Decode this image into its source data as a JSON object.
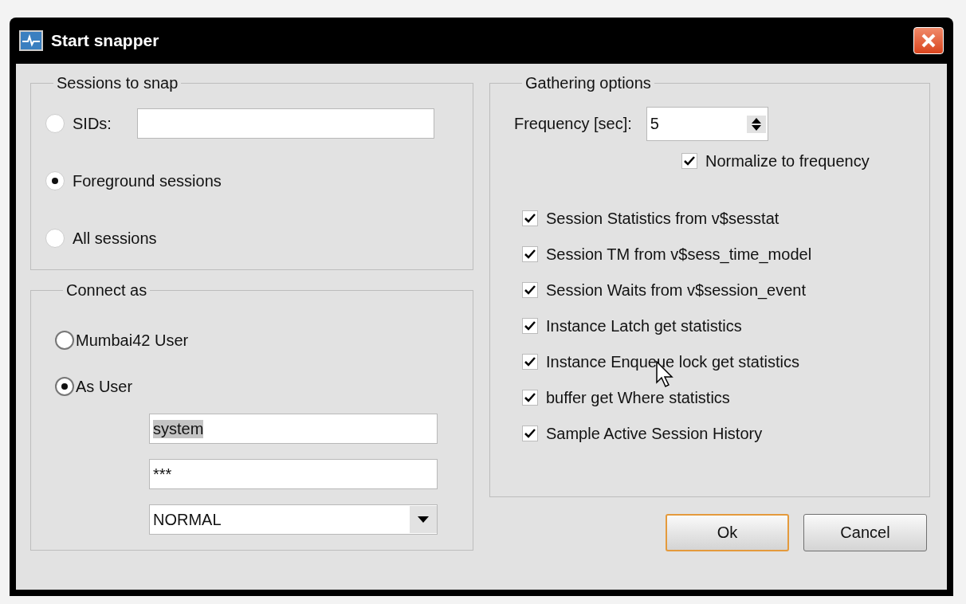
{
  "window": {
    "title": "Start snapper"
  },
  "sessions_group": {
    "title": "Sessions to snap",
    "options": [
      {
        "kind": "field",
        "label": "SIDs:",
        "selected": false
      },
      {
        "kind": "plain",
        "label": "Foreground sessions",
        "selected": true
      },
      {
        "kind": "plain",
        "label": "All sessions",
        "selected": false
      }
    ]
  },
  "connect_group": {
    "title": "Connect as",
    "options": [
      {
        "label": "Mumbai42 User",
        "selected": false
      },
      {
        "label": "As User",
        "selected": true
      }
    ],
    "username": {
      "value": "system",
      "text_selected": true
    },
    "password": {
      "value": "***"
    },
    "role_dropdown": {
      "value": "NORMAL"
    }
  },
  "gathering_group": {
    "title": "Gathering options",
    "frequency": {
      "label": "Frequency [sec]:",
      "value": "5"
    },
    "normalize": {
      "label": "Normalize to frequency",
      "checked": true
    },
    "options": [
      {
        "label": "Session Statistics from v$sesstat",
        "checked": true
      },
      {
        "label": "Session TM from v$sess_time_model",
        "checked": true
      },
      {
        "label": "Session Waits from v$session_event",
        "checked": true
      },
      {
        "label": "Instance Latch get statistics",
        "checked": true
      },
      {
        "label": "Instance Enqueue lock get statistics",
        "checked": true
      },
      {
        "label": "buffer get Where statistics",
        "checked": true
      },
      {
        "label": "Sample Active Session History",
        "checked": true
      }
    ]
  },
  "buttons": [
    {
      "label": "Ok",
      "default": true
    },
    {
      "label": "Cancel",
      "default": false
    }
  ]
}
